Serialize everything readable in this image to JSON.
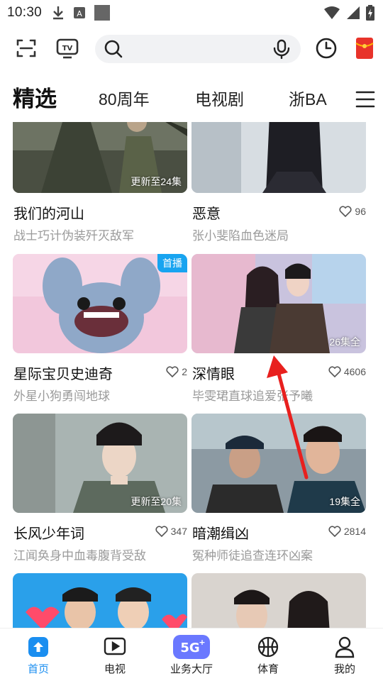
{
  "status_bar": {
    "time": "10:30",
    "icons": [
      "download-icon",
      "text-notification-icon",
      "square-notification-icon",
      "wifi-icon",
      "signal-icon",
      "battery-charging-icon"
    ]
  },
  "top_bar": {
    "icons": [
      "scan-icon",
      "tv-cast-icon",
      "history-clock-icon",
      "red-envelope-icon"
    ],
    "search": {
      "placeholder": "",
      "value": ""
    }
  },
  "tabs": [
    {
      "label": "精选",
      "active": true
    },
    {
      "label": "80周年",
      "active": false
    },
    {
      "label": "电视剧",
      "active": false
    },
    {
      "label": "浙BA",
      "active": false
    }
  ],
  "cards": [
    {
      "title": "我们的河山",
      "subtitle": "战士巧计伪装歼灭敌军",
      "badge": "更新至24集",
      "likes": ""
    },
    {
      "title": "恶意",
      "subtitle": "张小斐陷血色迷局",
      "badge": "",
      "likes": "96"
    },
    {
      "title": "星际宝贝史迪奇",
      "subtitle": "外星小狗勇闯地球",
      "badge": "首播",
      "likes": "2"
    },
    {
      "title": "深情眼",
      "subtitle": "毕雯珺直球追爱张予曦",
      "badge": "26集全",
      "likes": "4606"
    },
    {
      "title": "长风少年词",
      "subtitle": "江闻奂身中血毒腹背受敌",
      "badge": "更新至20集",
      "likes": "347"
    },
    {
      "title": "暗潮缉凶",
      "subtitle": "冤种师徒追查连环凶案",
      "badge": "19集全",
      "likes": "2814"
    },
    {
      "title": "",
      "subtitle": "",
      "badge": "",
      "likes": ""
    },
    {
      "title": "",
      "subtitle": "",
      "badge": "",
      "likes": ""
    }
  ],
  "bottom_nav": [
    {
      "label": "首页",
      "icon": "home-upload-icon",
      "active": true
    },
    {
      "label": "电视",
      "icon": "tv-play-icon",
      "active": false
    },
    {
      "label": "业务大厅",
      "icon": "5g-plus-icon",
      "active": false
    },
    {
      "label": "体育",
      "icon": "basketball-icon",
      "active": false
    },
    {
      "label": "我的",
      "icon": "profile-icon",
      "active": false
    }
  ],
  "colors": {
    "accent": "#1a8ef0",
    "badge_blue": "#18a4f0",
    "annotation_red": "#e8201e",
    "subtitle_gray": "#9a9a9a"
  }
}
